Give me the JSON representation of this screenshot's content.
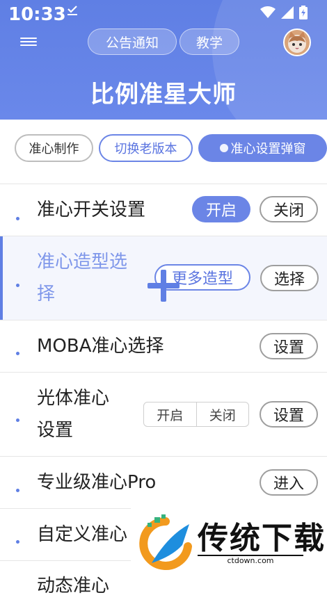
{
  "status_bar": {
    "time": "10:33",
    "notif_icon": "download-done-icon",
    "icons": [
      "wifi-icon",
      "signal-icon",
      "battery-icon"
    ]
  },
  "header": {
    "menu_icon": "hamburger-menu-icon",
    "tabs": [
      {
        "label": "公告通知"
      },
      {
        "label": "教学"
      }
    ],
    "avatar": "cat-avatar",
    "title": "比例准星大师",
    "colors": {
      "primary": "#5f7fe4",
      "accent": "#6b85e6"
    }
  },
  "chips": [
    {
      "label": "准心制作",
      "style": "outline"
    },
    {
      "label": "切换老版本",
      "style": "blue-outline"
    },
    {
      "label": "准心设置弹窗",
      "style": "solid"
    }
  ],
  "rows": [
    {
      "label": "准心开关设置",
      "actions": [
        "开启",
        "关闭"
      ]
    },
    {
      "label_line1": "准心造型选",
      "label_line2": "择",
      "actions": [
        "更多造型",
        "选择"
      ]
    },
    {
      "label": "MOBA准心选择",
      "actions": [
        "设置"
      ]
    },
    {
      "label_line1": "光体准心",
      "label_line2": "设置",
      "segment": [
        "开启",
        "关闭"
      ],
      "actions": [
        "设置"
      ]
    },
    {
      "label": "专业级准心Pro",
      "actions": [
        "进入"
      ]
    },
    {
      "label": "自定义准心"
    },
    {
      "label": "动态准心"
    }
  ],
  "watermark": {
    "brand": "传统下载",
    "url": "ctdown.com"
  }
}
